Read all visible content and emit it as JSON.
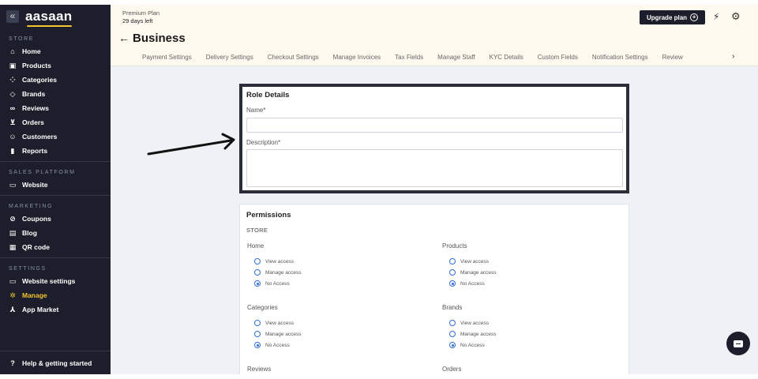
{
  "sidebar": {
    "logo": "aasaan",
    "collapse_icon": "«",
    "sections": [
      {
        "label": "STORE",
        "items": [
          {
            "label": "Home",
            "icon": "home-icon",
            "glyph": "⌂"
          },
          {
            "label": "Products",
            "icon": "products-icon",
            "glyph": "▣"
          },
          {
            "label": "Categories",
            "icon": "categories-icon",
            "glyph": "⁘"
          },
          {
            "label": "Brands",
            "icon": "tag-icon",
            "glyph": "◇"
          },
          {
            "label": "Reviews",
            "icon": "link-icon",
            "glyph": "∞"
          },
          {
            "label": "Orders",
            "icon": "cart-icon",
            "glyph": "⊻"
          },
          {
            "label": "Customers",
            "icon": "users-icon",
            "glyph": "☺"
          },
          {
            "label": "Reports",
            "icon": "chart-icon",
            "glyph": "▮"
          }
        ]
      },
      {
        "label": "SALES PLATFORM",
        "items": [
          {
            "label": "Website",
            "icon": "monitor-icon",
            "glyph": "▭"
          }
        ]
      },
      {
        "label": "MARKETING",
        "items": [
          {
            "label": "Coupons",
            "icon": "coupon-icon",
            "glyph": "⊘"
          },
          {
            "label": "Blog",
            "icon": "blog-icon",
            "glyph": "▤"
          },
          {
            "label": "QR code",
            "icon": "qr-icon",
            "glyph": "▦"
          }
        ]
      },
      {
        "label": "SETTINGS",
        "items": [
          {
            "label": "Website settings",
            "icon": "website-settings-icon",
            "glyph": "▭"
          },
          {
            "label": "Manage",
            "icon": "gear-icon",
            "glyph": "✲",
            "active": true
          },
          {
            "label": "App Market",
            "icon": "app-market-icon",
            "glyph": "⅄"
          }
        ]
      }
    ],
    "footer": {
      "label": "Help & getting started",
      "icon": "help-icon",
      "glyph": "?"
    }
  },
  "topbar": {
    "plan_name": "Premium Plan",
    "plan_days": "29 days left",
    "upgrade_label": "Upgrade plan",
    "upgrade_glyph": "+",
    "bolt_glyph": "⚡",
    "gear_glyph": "⚙",
    "back_glyph": "←",
    "title": "Business",
    "tabs": [
      "Payment Settings",
      "Delivery Settings",
      "Checkout Settings",
      "Manage Invoices",
      "Tax Fields",
      "Manage Staff",
      "KYC Details",
      "Custom Fields",
      "Notification Settings",
      "Review"
    ],
    "tabs_next_glyph": "›"
  },
  "role_details": {
    "title": "Role Details",
    "name_label": "Name*",
    "name_value": "",
    "description_label": "Description*",
    "description_value": ""
  },
  "permissions": {
    "title": "Permissions",
    "section": "STORE",
    "options": [
      "View access",
      "Manage access",
      "No Access"
    ],
    "groups": [
      {
        "name": "Home",
        "selected": 2
      },
      {
        "name": "Products",
        "selected": 2
      },
      {
        "name": "Categories",
        "selected": 2
      },
      {
        "name": "Brands",
        "selected": 2
      },
      {
        "name": "Reviews",
        "selected": 2
      },
      {
        "name": "Orders",
        "selected": 2
      }
    ]
  },
  "colors": {
    "sidebar_bg": "#1c1f2b",
    "accent": "#f2c230",
    "radio": "#2f6fd6",
    "topbar_bg": "#fffaf0",
    "content_bg": "#eef1f5"
  }
}
